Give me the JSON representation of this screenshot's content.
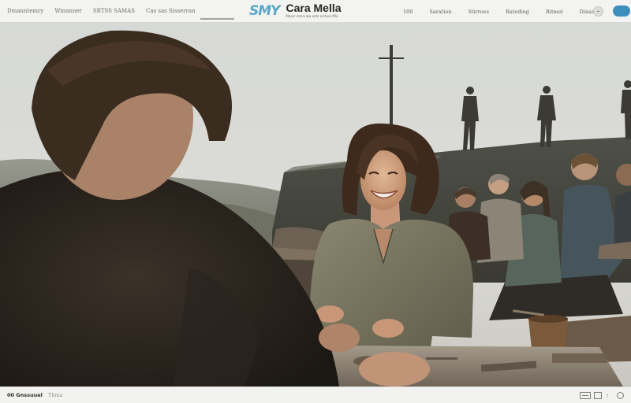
{
  "header": {
    "nav_left": [
      "Dmanntemry",
      "Winanner",
      "SRTSS SAMAS",
      "Cas sas Sisserran"
    ],
    "active_index": 3,
    "brand_logo": "SMY",
    "brand_title": "Cara Mella",
    "brand_subtitle": "Maser Interview ants arctuss Mla",
    "nav_right": [
      "100",
      "Saration",
      "Stirroes",
      "Rateding",
      "Ritmel",
      "Dinaite"
    ],
    "cta_label": ""
  },
  "player": {
    "time_label": "00 Gnssuuel",
    "secondary_label": "Thma",
    "controls": [
      "captions-icon",
      "fullscreen-icon",
      "share-icon",
      "settings-icon"
    ]
  },
  "colors": {
    "accent": "#3c8fbd",
    "brand": "#5aa7c9",
    "bar_bg": "#f3f3f1"
  }
}
